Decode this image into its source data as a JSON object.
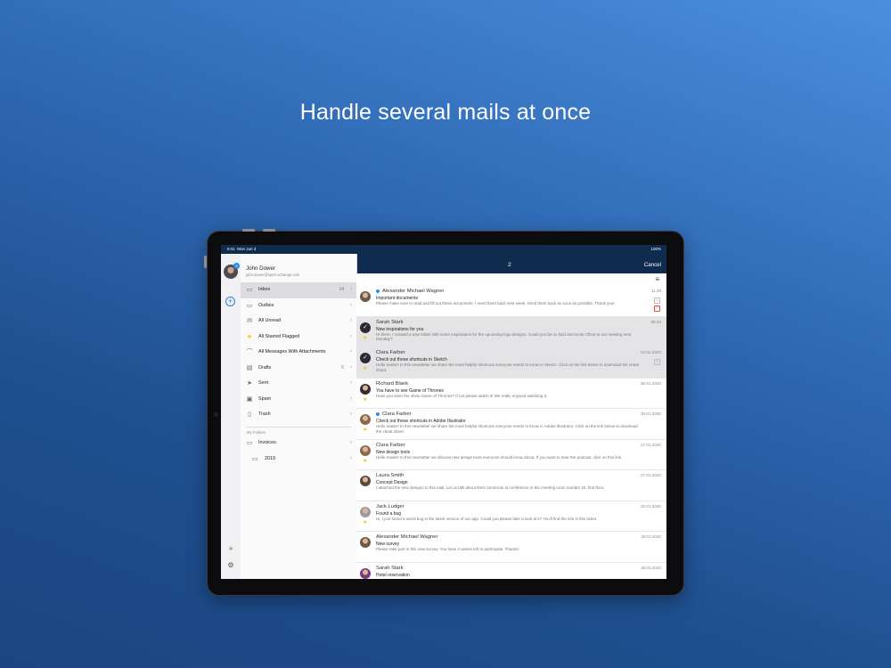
{
  "headline": "Handle several mails at once",
  "status": {
    "time": "9:41",
    "date": "Mon Jun 3",
    "battery": "100%"
  },
  "account": {
    "name": "John Dower",
    "email": "john.dower@open-xchange.com",
    "badge": "9"
  },
  "folders": [
    {
      "label": "Inbox",
      "count": "14",
      "icon": "inbox-icon",
      "glyph": "▭",
      "active": true
    },
    {
      "label": "Outbox",
      "count": "",
      "icon": "outbox-icon",
      "glyph": "▭"
    },
    {
      "label": "All Unread",
      "count": "",
      "icon": "unread-icon",
      "glyph": "✉"
    },
    {
      "label": "All Starred Flagged",
      "count": "",
      "icon": "star-icon",
      "glyph": "★"
    },
    {
      "label": "All Messages With Attachments",
      "count": "",
      "icon": "paperclip-icon",
      "glyph": "⌒"
    },
    {
      "label": "Drafts",
      "count": "5",
      "icon": "drafts-icon",
      "glyph": "▤"
    },
    {
      "label": "Sent",
      "count": "",
      "icon": "sent-icon",
      "glyph": "➤"
    },
    {
      "label": "Spam",
      "count": "",
      "icon": "spam-icon",
      "glyph": "▣"
    },
    {
      "label": "Trash",
      "count": "",
      "icon": "trash-icon",
      "glyph": "▯"
    }
  ],
  "my_folders_label": "My Folders",
  "custom_folders": [
    {
      "label": "Invoices",
      "icon": "folder-icon"
    },
    {
      "label": "2019",
      "icon": "folder-icon"
    }
  ],
  "mail_header": {
    "selected_count": "2",
    "cancel": "Cancel"
  },
  "mails": [
    {
      "sender": "Alexander Michael Wagner",
      "date": "11:45",
      "subject": "Important documents",
      "preview": "Please make sure to read and fill out these documents. I need them back next week. Send them back as soon as possible. Thank you!",
      "unread": true,
      "selected": false,
      "starred": false,
      "avatar_color": "#6a5a4a",
      "badges": [
        "1",
        "!"
      ]
    },
    {
      "sender": "Sarah Stark",
      "date": "09:45",
      "subject": "New inspirations for you",
      "preview": "Hi there, I created a new folder with some inspirations for the upcoming logo designs. Could you be so kind and invite Chloe to our meeting next Monday?",
      "unread": false,
      "selected": true,
      "starred": true,
      "avatar_color": "#7a4a6a",
      "badges": []
    },
    {
      "sender": "Clara Farber",
      "date": "02.02.2020",
      "subject": "Check out these shortcuts in Sketch",
      "preview": "Hello reader! In this newsletter we share the most helpful shortcuts everyone needs to know in Sketch. Click on the link below to download the cheat sheet.",
      "unread": false,
      "selected": true,
      "starred": true,
      "avatar_color": "#8a6a4a",
      "badges": [
        "1"
      ]
    },
    {
      "sender": "Richard Blank",
      "date": "30.01.2020",
      "subject": "You have to see Game of Thrones",
      "preview": "Have you seen the show Game of Thrones? If not please watch it! We really enjoyed watching it.",
      "unread": false,
      "selected": false,
      "starred": true,
      "avatar_color": "#3a2a2a",
      "badges": []
    },
    {
      "sender": "Clara Farber",
      "date": "30.01.2020",
      "subject": "Check out these shortcuts in Adobe Illustrator",
      "preview": "Hello reader! In this newsletter we share the most helpful shortcuts everyone needs to know in Adobe Illustrator. Click on the link below to download the cheat sheet.",
      "unread": true,
      "selected": false,
      "starred": true,
      "avatar_color": "#8a6a4a",
      "badges": []
    },
    {
      "sender": "Clara Farber",
      "date": "27.01.2020",
      "subject": "New design tools",
      "preview": "Hello reader! In this newsletter we discuss new design tools everyone should know about. If you want to hear the podcast, click on this link.",
      "unread": false,
      "selected": false,
      "starred": true,
      "avatar_color": "#8a6a4a",
      "badges": []
    },
    {
      "sender": "Laura Smith",
      "date": "27.01.2020",
      "subject": "Concept Design",
      "preview": "I attached the new designs to this mail. Let us talk about them tomorrow at conference in the meeting room number 20, first floor.",
      "unread": false,
      "selected": false,
      "starred": false,
      "avatar_color": "#5a4a3a",
      "badges": []
    },
    {
      "sender": "Jack Ludger",
      "date": "20.01.2020",
      "subject": "Found a bug",
      "preview": "Hi, I just found a weird bug in the latest version of our app. Could you please take a look at it? You'll find the info in this ticket.",
      "unread": false,
      "selected": false,
      "starred": true,
      "avatar_color": "#9a9aa2",
      "badges": []
    },
    {
      "sender": "Alexander Michael Wagner",
      "date": "19.01.2020",
      "subject": "New survey",
      "preview": "Please take part in this new survey. You have 2 weeks left to participate. Thanks!",
      "unread": false,
      "selected": false,
      "starred": false,
      "avatar_color": "#6a5a4a",
      "badges": []
    },
    {
      "sender": "Sarah Stark",
      "date": "19.01.2020",
      "subject": "Hotel reservation",
      "preview": "",
      "unread": false,
      "selected": false,
      "starred": false,
      "avatar_color": "#7a3a7a",
      "badges": []
    }
  ]
}
